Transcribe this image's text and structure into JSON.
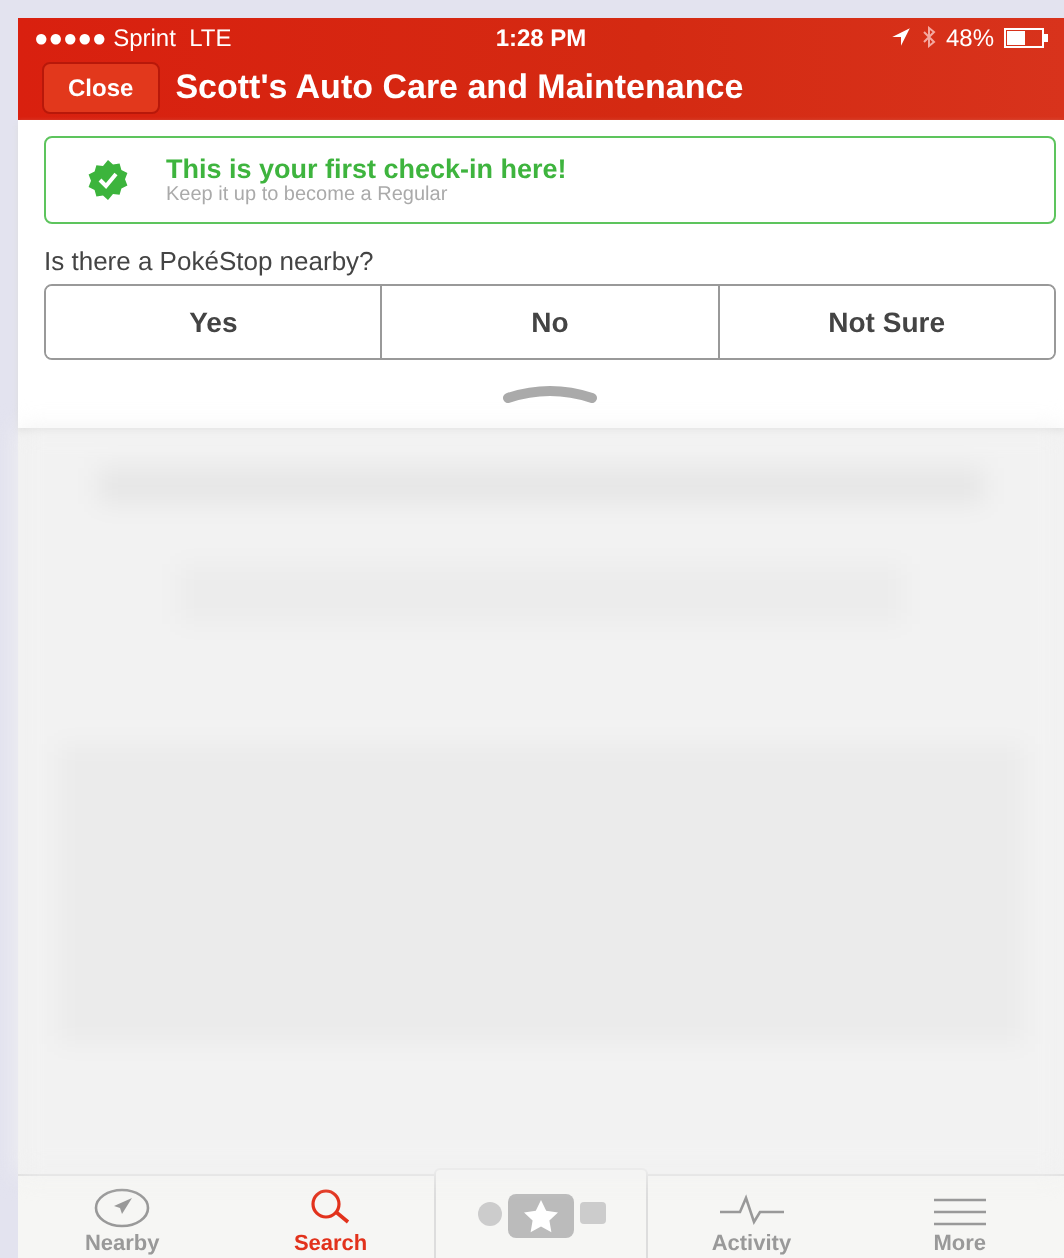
{
  "status_bar": {
    "carrier": "●●●●● Sprint  LTE",
    "time": "1:28 PM",
    "battery": "48%"
  },
  "nav": {
    "close_button": "Close",
    "title": "Scott's Auto Care and Maintenance"
  },
  "checkin": {
    "title": "This is your first check-in here!",
    "subtitle": "Keep it up to become a Regular"
  },
  "question": {
    "text": "Is there a PokéStop nearby?",
    "options": [
      {
        "label": "Yes",
        "selected": false
      },
      {
        "label": "No",
        "selected": false
      },
      {
        "label": "Not Sure",
        "selected": false
      }
    ]
  },
  "tab_bar": [
    {
      "label": "Nearby",
      "kind": "nearby",
      "selected": false
    },
    {
      "label": "Search",
      "kind": "search",
      "selected": true
    },
    {
      "kind": "checkin",
      "selected": false
    },
    {
      "label": "Activity",
      "kind": "activity",
      "selected": false
    },
    {
      "label": "More",
      "kind": "more",
      "selected": false
    }
  ]
}
